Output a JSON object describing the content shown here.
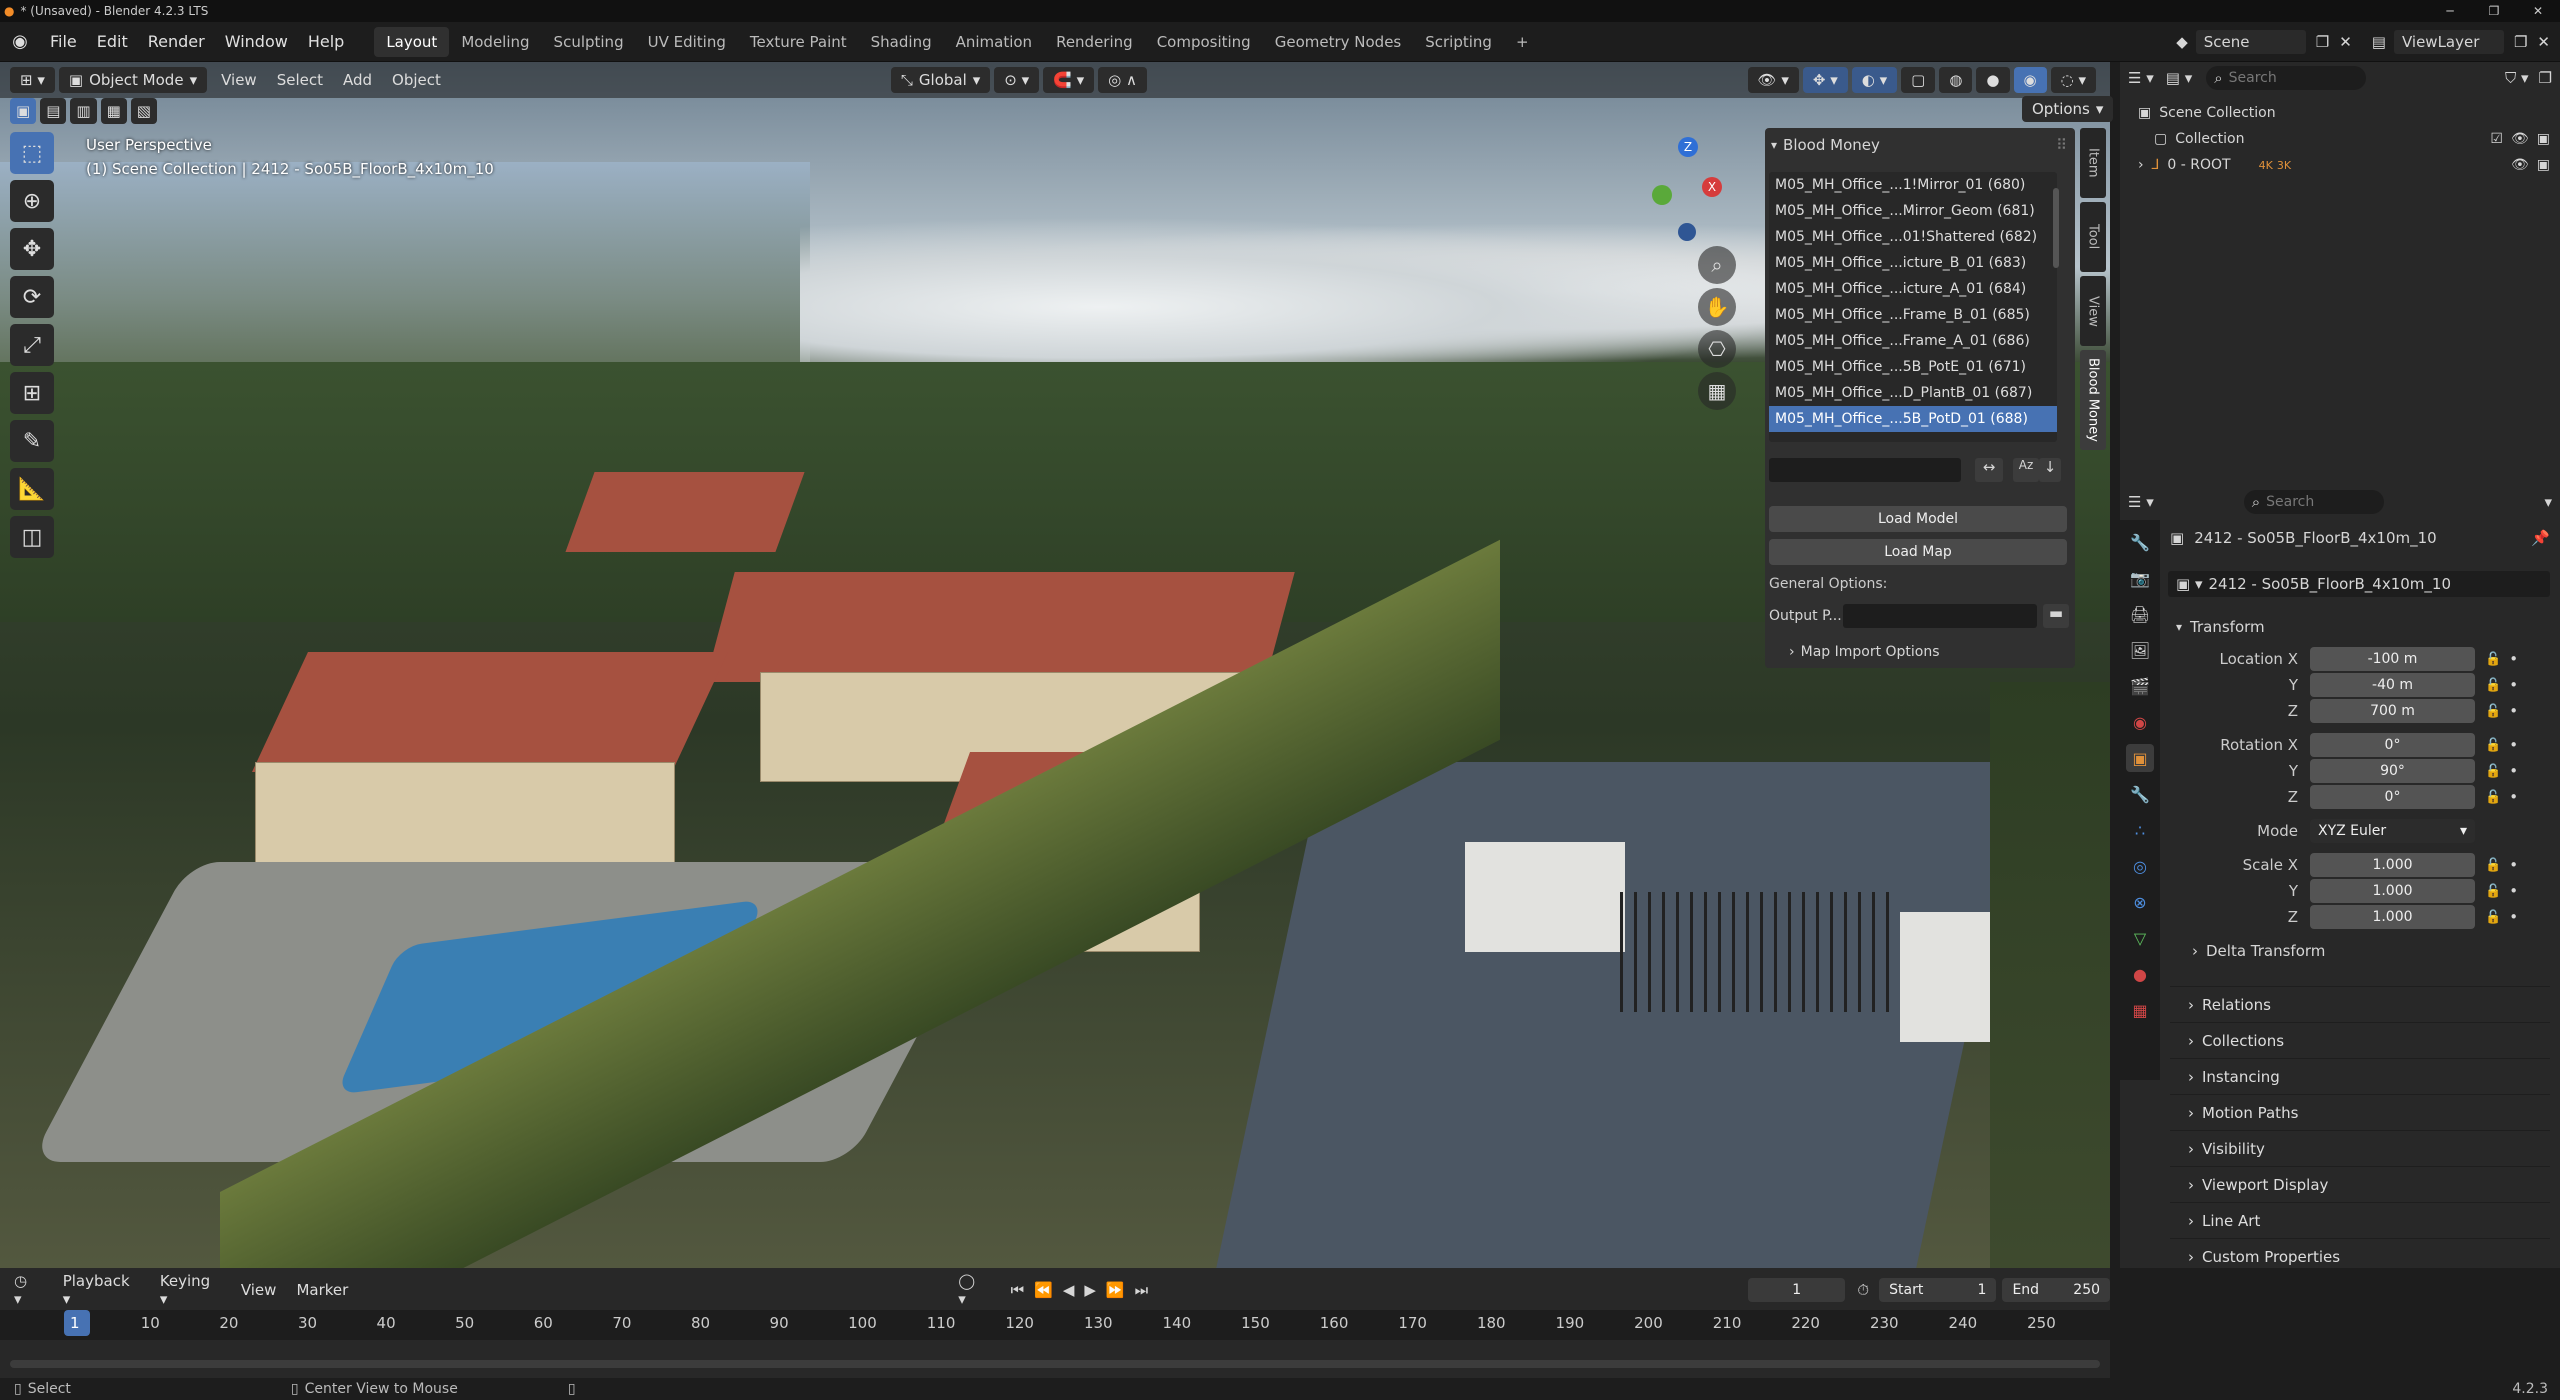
{
  "window": {
    "title": "* (Unsaved) - Blender 4.2.3 LTS"
  },
  "menu": {
    "file": "File",
    "edit": "Edit",
    "render": "Render",
    "window": "Window",
    "help": "Help"
  },
  "workspaces": [
    "Layout",
    "Modeling",
    "Sculpting",
    "UV Editing",
    "Texture Paint",
    "Shading",
    "Animation",
    "Rendering",
    "Compositing",
    "Geometry Nodes",
    "Scripting"
  ],
  "active_workspace": "Layout",
  "scene": {
    "label": "Scene",
    "view_layer": "ViewLayer"
  },
  "viewport": {
    "mode": "Object Mode",
    "view": "View",
    "select": "Select",
    "add": "Add",
    "object": "Object",
    "transform_orientation": "Global",
    "options": "Options",
    "perspective": "User Perspective",
    "info": "(1) Scene Collection | 2412 - So05B_FloorB_4x10m_10"
  },
  "npanel": {
    "title": "Blood Money",
    "tabs": [
      "Item",
      "Tool",
      "View",
      "Blood Money"
    ],
    "items": [
      "M05_MH_Office_...1!Mirror_01 (680)",
      "M05_MH_Office_...Mirror_Geom (681)",
      "M05_MH_Office_...01!Shattered (682)",
      "M05_MH_Office_...icture_B_01 (683)",
      "M05_MH_Office_...icture_A_01 (684)",
      "M05_MH_Office_...Frame_B_01 (685)",
      "M05_MH_Office_...Frame_A_01 (686)",
      "M05_MH_Office_...5B_PotE_01 (671)",
      "M05_MH_Office_...D_PlantB_01 (687)",
      "M05_MH_Office_...5B_PotD_01 (688)"
    ],
    "selected_index": 9,
    "load_model": "Load Model",
    "load_map": "Load Map",
    "general_options": "General Options:",
    "output_path_label": "Output P...",
    "map_import_options": "Map Import Options"
  },
  "outliner": {
    "search_placeholder": "Search",
    "scene_collection": "Scene Collection",
    "collection": "Collection",
    "root": "0 - ROOT",
    "badge_4k": "4K",
    "badge_3k": "3K"
  },
  "properties": {
    "search_placeholder": "Search",
    "object_name": "2412 - So05B_FloorB_4x10m_10",
    "datablock_name": "2412 - So05B_FloorB_4x10m_10",
    "transform": "Transform",
    "location_x_label": "Location X",
    "location": [
      "-100 m",
      "-40 m",
      "700 m"
    ],
    "rotation_x_label": "Rotation X",
    "rotation": [
      "0°",
      "90°",
      "0°"
    ],
    "y_label": "Y",
    "z_label": "Z",
    "mode_label": "Mode",
    "mode_value": "XYZ Euler",
    "scale_x_label": "Scale X",
    "scale": [
      "1.000",
      "1.000",
      "1.000"
    ],
    "delta_transform": "Delta Transform",
    "sections": [
      "Relations",
      "Collections",
      "Instancing",
      "Motion Paths",
      "Visibility",
      "Viewport Display",
      "Line Art",
      "Custom Properties"
    ]
  },
  "timeline": {
    "playback": "Playback",
    "keying": "Keying",
    "view": "View",
    "marker": "Marker",
    "current_frame": "1",
    "start_label": "Start",
    "start": "1",
    "end_label": "End",
    "end": "250",
    "ticks": [
      "1",
      "10",
      "20",
      "30",
      "40",
      "50",
      "60",
      "70",
      "80",
      "90",
      "100",
      "110",
      "120",
      "130",
      "140",
      "150",
      "160",
      "170",
      "180",
      "190",
      "200",
      "210",
      "220",
      "230",
      "240",
      "250"
    ]
  },
  "status": {
    "select": "Select",
    "center_view": "Center View to Mouse",
    "version": "4.2.3"
  },
  "colors": {
    "accent": "#4772b3",
    "panel": "#303030",
    "header": "#1d1d1d"
  }
}
